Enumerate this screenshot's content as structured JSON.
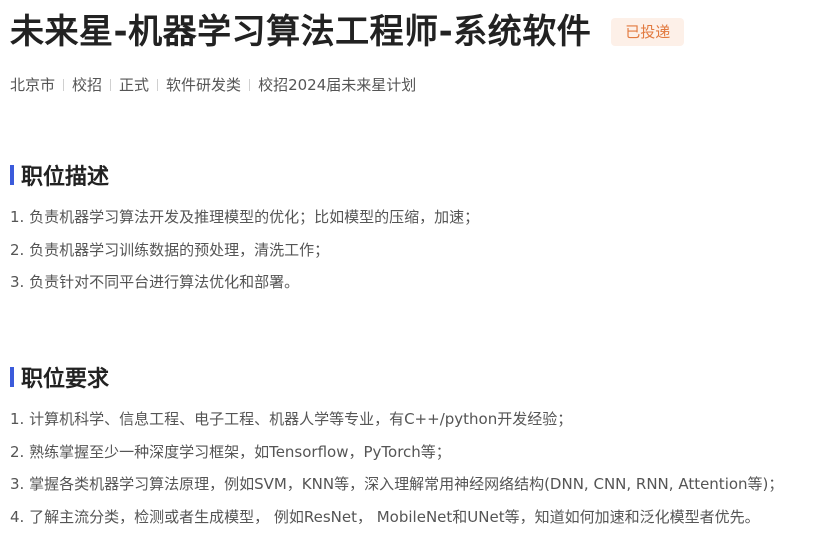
{
  "job": {
    "title": "未来星-机器学习算法工程师-系统软件",
    "status": "已投递",
    "meta": [
      "北京市",
      "校招",
      "正式",
      "软件研发类",
      "校招2024届未来星计划"
    ]
  },
  "description": {
    "heading": "职位描述",
    "items": [
      "1. 负责机器学习算法开发及推理模型的优化；比如模型的压缩，加速；",
      "2. 负责机器学习训练数据的预处理，清洗工作；",
      "3. 负责针对不同平台进行算法优化和部署。"
    ]
  },
  "requirements": {
    "heading": "职位要求",
    "items": [
      "1. 计算机科学、信息工程、电子工程、机器人学等专业，有C++/python开发经验；",
      "2. 熟练掌握至少一种深度学习框架，如Tensorflow，PyTorch等；",
      "3. 掌握各类机器学习算法原理，例如SVM，KNN等，深入理解常用神经网络结构(DNN, CNN, RNN, Attention等)；",
      "4. 了解主流分类，检测或者生成模型， 例如ResNet， MobileNet和UNet等，知道如何加速和泛化模型者优先。"
    ]
  },
  "colors": {
    "accent": "#3b5bdb",
    "badge_text": "#e27a3f",
    "badge_bg": "#fdf0e8"
  }
}
